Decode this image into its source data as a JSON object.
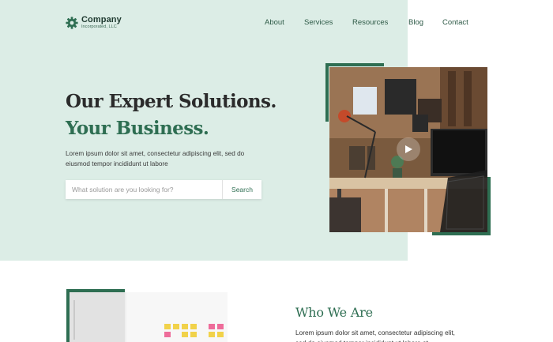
{
  "brand": {
    "name": "Company",
    "subtitle": "Incorporated, LLC"
  },
  "nav": {
    "items": [
      "About",
      "Services",
      "Resources",
      "Blog",
      "Contact"
    ]
  },
  "hero": {
    "title_line1": "Our Expert Solutions.",
    "title_line2": "Your Business.",
    "description": "Lorem ipsum dolor sit amet, consectetur adipiscing elit, sed do eiusmod tempor incididunt ut labore",
    "search_placeholder": "What solution are you looking for?",
    "search_button": "Search"
  },
  "about": {
    "title": "Who We Are",
    "description": "Lorem ipsum dolor sit amet, consectetur adipiscing elit, sed do eiusmod tempor incididunt ut labore et"
  },
  "colors": {
    "accent": "#2e6e52",
    "hero_background": "#dcede6",
    "heading": "#2b2b2b"
  },
  "icons": {
    "logo": "gear-logo-icon",
    "play": "play-icon"
  }
}
